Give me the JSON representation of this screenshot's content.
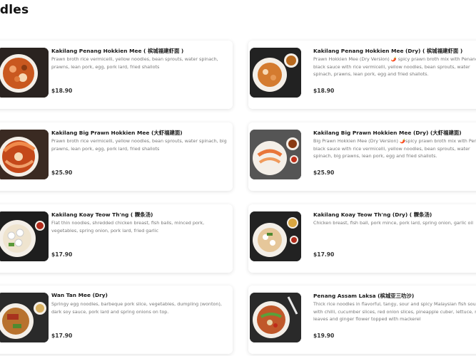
{
  "section": {
    "title": "odles"
  },
  "items": [
    {
      "name": "Kakilang Penang Hokkien Mee ( 槟城福建虾面 )",
      "desc": "Prawn broth rice vermicelli, yellow noodles, bean sprouts, water spinach, prawns, lean pork, egg, pork lard, fried shallots",
      "price": "$18.90"
    },
    {
      "name": "Kakilang Penang Hokkien Mee (Dry) ( 槟城福建虾面 )",
      "desc": "Prawn Hokkien Mee (Dry Version) 🌶️ spicy prawn broth mix with Penang black sauce with rice vermicelli, yellow noodles, bean sprouts, water spinach, prawns, lean pork, egg and fried shallots.",
      "price": "$18.90"
    },
    {
      "name": "Kakilang Big Prawn Hokkien Mee (大虾福建面)",
      "desc": "Prawn broth rice vermicelli, yellow noodles, bean sprouts, water spinach, big prawns, lean pork, egg, pork lard, fried shallots",
      "price": "$25.90"
    },
    {
      "name": "Kakilang Big Prawn Hokkien Mee (Dry) (大虾福建面)",
      "desc": "Big Prawn Hokkien Mee (Dry Version) 🌶️spicy prawn broth mix with Penang black sauce with rice vermicelli, yellow noodles, bean sprouts, water spinach, big prawns, lean pork, egg and fried shallots.",
      "price": "$25.90"
    },
    {
      "name": "Kakilang Koay Teow Th'ng ( 粿条汤)",
      "desc": "Flat thin noodles, shredded chicken breast, fish balls, minced pork, vegetables, spring onion, pork lard, fried garlic",
      "price": "$17.90"
    },
    {
      "name": "Kakilang Koay Teow Th'ng (Dry) ( 粿条汤)",
      "desc": "Chicken breast, fish ball, pork mince, pork lard, spring onion, garlic oil",
      "price": "$17.90"
    },
    {
      "name": "Wan Tan Mee (Dry)",
      "desc": "Springy egg noodles, barbeque pork slice, vegetables, dumpling (wonton), dark soy sauce, pork lard and spring onions on top.",
      "price": "$17.90"
    },
    {
      "name": "Penang Assam Laksa (槟城亚三叻沙)",
      "desc": "Thick rice noodles in flavorful, tangy, sour and spicy Malaysian fish soup with chilli, cucumber slices, red onion slices, pineapple cuber, lettuce, mint leaves and ginger flower topped with mackerel",
      "price": "$19.90"
    }
  ]
}
